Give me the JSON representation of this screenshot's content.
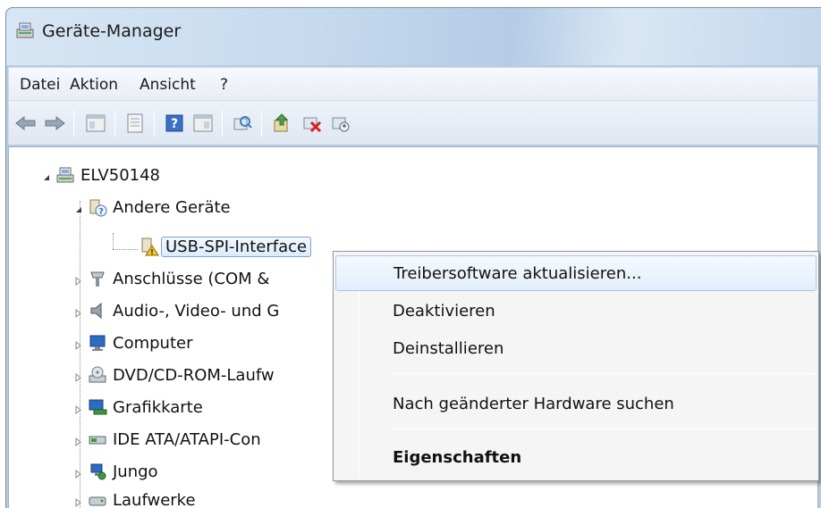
{
  "window": {
    "title": "Geräte-Manager"
  },
  "menubar": {
    "items": [
      "Datei",
      "Aktion",
      "Ansicht",
      "?"
    ]
  },
  "toolbar": {
    "buttons": [
      "back-arrow-icon",
      "forward-arrow-icon",
      "show-hide-console-tree-icon",
      "properties-sheet-icon",
      "help-icon",
      "view-icon",
      "scan-hardware-icon",
      "update-driver-icon",
      "uninstall-icon",
      "disable-icon"
    ]
  },
  "tree": {
    "root": "ELV50148",
    "other_devices": "Andere Geräte",
    "usb_spi": "USB-SPI-Interface",
    "items": [
      "Anschlüsse (COM &",
      "Audio-, Video- und G",
      "Computer",
      "DVD/CD-ROM-Laufw",
      "Grafikkarte",
      "IDE ATA/ATAPI-Con",
      "Jungo",
      "Laufwerke"
    ]
  },
  "context_menu": {
    "update_driver": "Treibersoftware aktualisieren...",
    "disable": "Deaktivieren",
    "uninstall": "Deinstallieren",
    "scan": "Nach geänderter Hardware suchen",
    "properties": "Eigenschaften"
  }
}
